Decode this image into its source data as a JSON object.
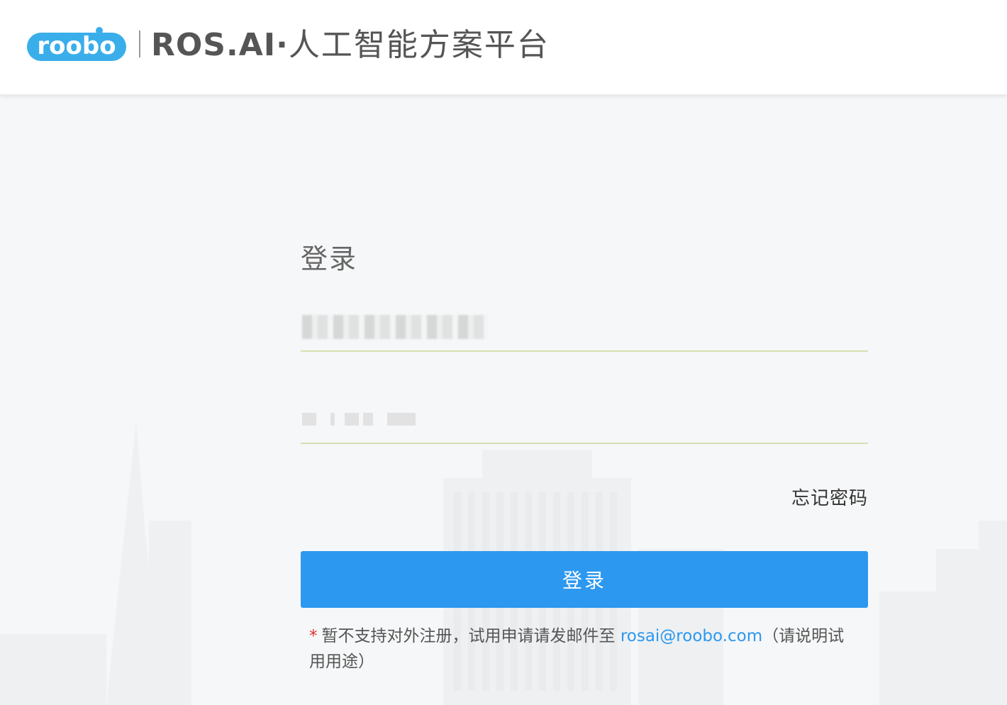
{
  "header": {
    "logo_text": "roobo",
    "brand_name": "ROS.AI",
    "brand_separator": "·",
    "brand_subtitle": "人工智能方案平台"
  },
  "login": {
    "title": "登录",
    "username": {
      "value": "",
      "masked": true
    },
    "password": {
      "value": "",
      "masked": true
    },
    "forgot_password_label": "忘记密码",
    "submit_label": "登录",
    "notice": {
      "asterisk": "*",
      "text_before": "暂不支持对外注册，试用申请请发邮件至 ",
      "email": "rosai@roobo.com",
      "text_after": "（请说明试用用途）"
    }
  },
  "colors": {
    "logo_blue": "#3aaeea",
    "primary_button": "#2d98ef",
    "link": "#2d98ef",
    "asterisk": "#e0352b",
    "input_underline": "#d6dfb0"
  },
  "icons": {
    "logo": "roobo-logo"
  }
}
